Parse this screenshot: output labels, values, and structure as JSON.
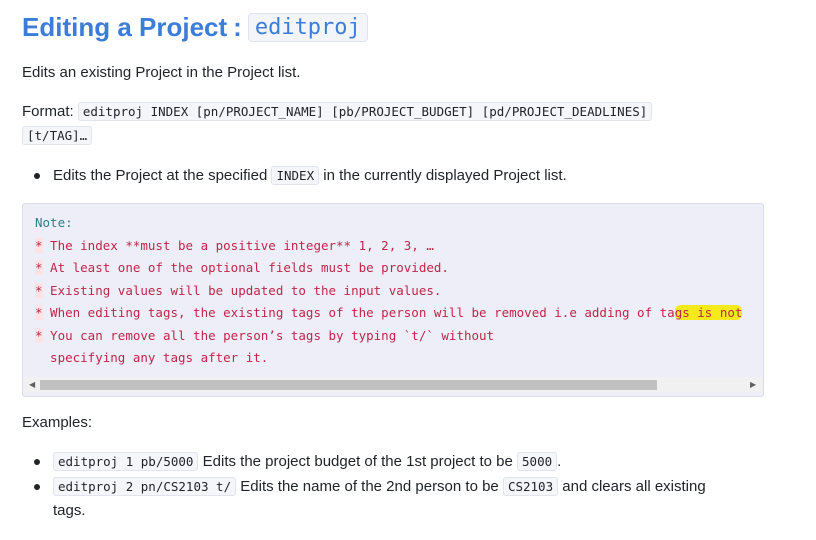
{
  "heading": {
    "title": "Editing a Project",
    "separator": ":",
    "command": "editproj"
  },
  "description": "Edits an existing Project in the Project list.",
  "format": {
    "label": "Format:",
    "code_line1": "editproj INDEX [pn/PROJECT_NAME] [pb/PROJECT_BUDGET] [pd/PROJECT_DEADLINES]",
    "code_line2": "[t/TAG]…"
  },
  "bullet1": {
    "before": "Edits the Project at the specified",
    "code": "INDEX",
    "after": "in the currently displayed Project list."
  },
  "note": {
    "label": "Note:",
    "star": "*",
    "line1": " The index **must be a positive integer** 1, 2, 3, …",
    "line2": " At least one of the optional fields must be provided.",
    "line3": " Existing values will be updated to the input values.",
    "line4_a": " When editing tags, the existing tags of the person will be removed i.e adding of ta",
    "line4_b": "gs is not",
    "line5": " You can remove all the person’s tags by typing `t/` without",
    "line6": "  specifying any tags after it.",
    "scroll_left": "◀",
    "scroll_right": "▶"
  },
  "examples_label": "Examples:",
  "example1": {
    "code": "editproj 1 pb/5000",
    "text": "Edits the project budget of the 1st project to be",
    "code2": "5000",
    "end": "."
  },
  "example2": {
    "code": "editproj 2 pn/CS2103 t/",
    "text": "Edits the name of the 2nd person to be",
    "code2": "CS2103",
    "text2": "and clears all existing",
    "cont": "tags."
  }
}
